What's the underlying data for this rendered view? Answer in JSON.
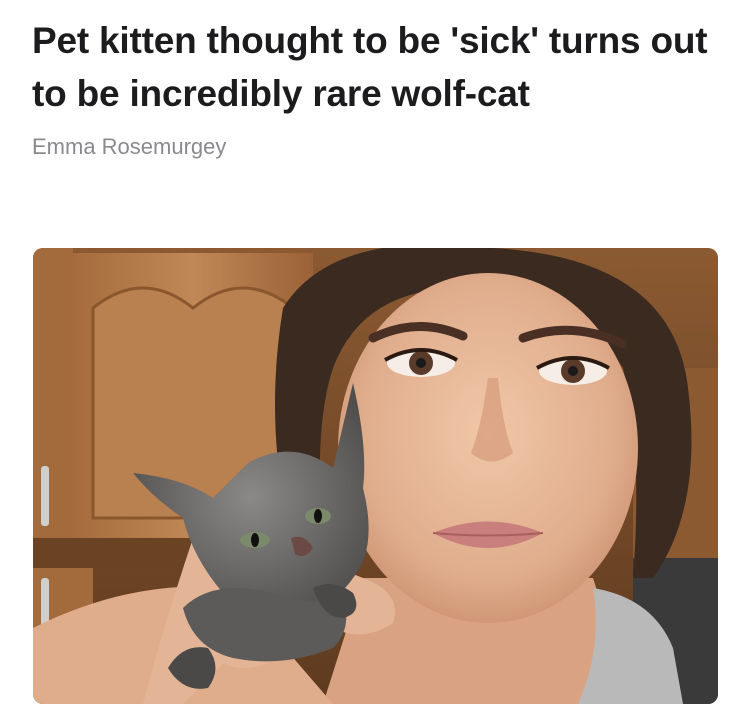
{
  "article": {
    "headline": "Pet kitten thought to be 'sick' turns out to be incredibly rare wolf-cat",
    "author": "Emma Rosemurgey"
  },
  "photo": {
    "alt": "woman holding grey kitten",
    "colors": {
      "cabinet": "#b3794a",
      "cabinet_dark": "#7a4a26",
      "skin": "#e3b596",
      "hair": "#3b2a20",
      "kitten_fur": "#6f6e6c",
      "tank_top": "#b9b9ba"
    }
  }
}
